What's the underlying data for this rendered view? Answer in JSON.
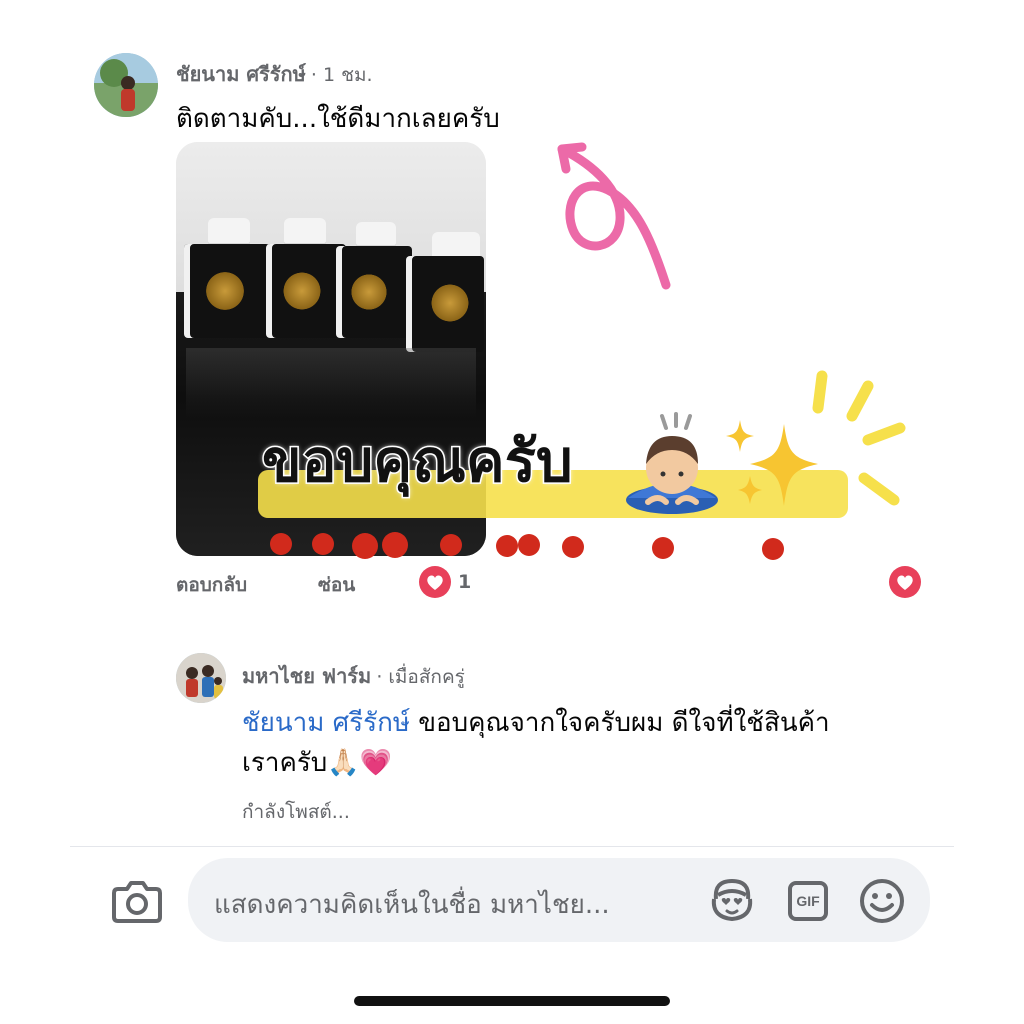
{
  "comment": {
    "author": "ชัยนาม ศรีรักษ์",
    "time": "· 1 ชม.",
    "text": "ติดตามคับ...ใช้ดีมากเลยครับ",
    "actions": {
      "reply": "ตอบกลับ",
      "hide": "ซ่อน",
      "reaction_count": "1"
    }
  },
  "sticker": {
    "text": "ขอบคุณครับ"
  },
  "reply": {
    "author": "มหาไชย ฟาร์ม",
    "time": "· เมื่อสักครู่",
    "mention": "ชัยนาม ศรีรักษ์",
    "text_line1": " ขอบคุณจากใจครับผม ดีใจที่ใช้สินค้า",
    "text_line2": "เราครับ🙏🏻💗",
    "status": "กำลังโพสต์..."
  },
  "composer": {
    "placeholder": "แสดงความคิดเห็นในชื่อ มหาไชย...",
    "gif_label": "GIF"
  },
  "colors": {
    "reaction_heart": "#e8405a",
    "mention_blue": "#2a6ac8",
    "sticker_yellow": "#f6e04b",
    "arrow_pink": "#ec6aa8",
    "dot_red": "#d12a1c"
  }
}
